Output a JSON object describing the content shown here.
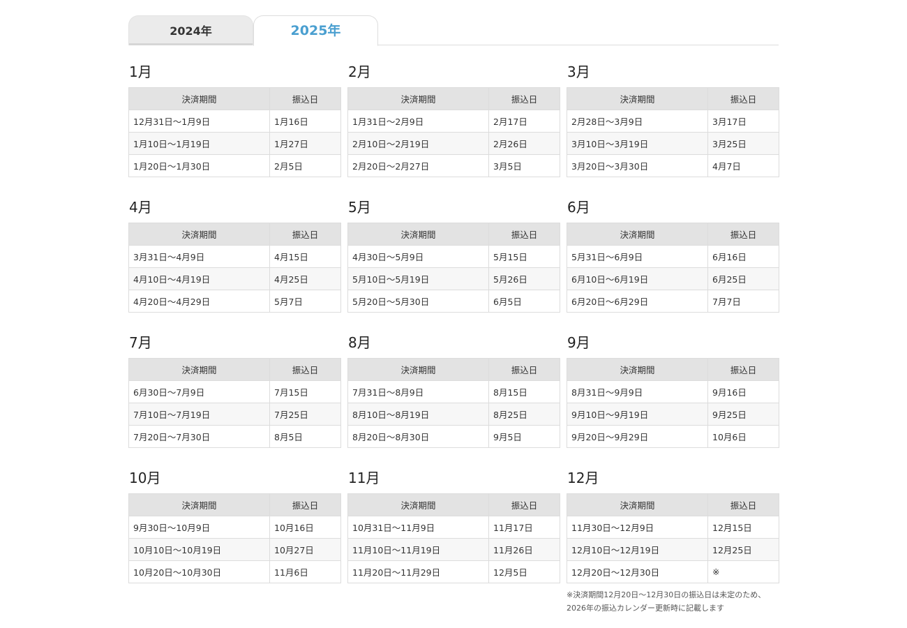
{
  "tabs": [
    {
      "label": "2024年",
      "active": false
    },
    {
      "label": "2025年",
      "active": true
    }
  ],
  "headers": {
    "period": "決済期間",
    "transfer": "振込日"
  },
  "months": [
    {
      "title": "1月",
      "rows": [
        [
          "12月31日〜1月9日",
          "1月16日"
        ],
        [
          "1月10日〜1月19日",
          "1月27日"
        ],
        [
          "1月20日〜1月30日",
          "2月5日"
        ]
      ]
    },
    {
      "title": "2月",
      "rows": [
        [
          "1月31日〜2月9日",
          "2月17日"
        ],
        [
          "2月10日〜2月19日",
          "2月26日"
        ],
        [
          "2月20日〜2月27日",
          "3月5日"
        ]
      ]
    },
    {
      "title": "3月",
      "rows": [
        [
          "2月28日〜3月9日",
          "3月17日"
        ],
        [
          "3月10日〜3月19日",
          "3月25日"
        ],
        [
          "3月20日〜3月30日",
          "4月7日"
        ]
      ]
    },
    {
      "title": "4月",
      "rows": [
        [
          "3月31日〜4月9日",
          "4月15日"
        ],
        [
          "4月10日〜4月19日",
          "4月25日"
        ],
        [
          "4月20日〜4月29日",
          "5月7日"
        ]
      ]
    },
    {
      "title": "5月",
      "rows": [
        [
          "4月30日〜5月9日",
          "5月15日"
        ],
        [
          "5月10日〜5月19日",
          "5月26日"
        ],
        [
          "5月20日〜5月30日",
          "6月5日"
        ]
      ]
    },
    {
      "title": "6月",
      "rows": [
        [
          "5月31日〜6月9日",
          "6月16日"
        ],
        [
          "6月10日〜6月19日",
          "6月25日"
        ],
        [
          "6月20日〜6月29日",
          "7月7日"
        ]
      ]
    },
    {
      "title": "7月",
      "rows": [
        [
          "6月30日〜7月9日",
          "7月15日"
        ],
        [
          "7月10日〜7月19日",
          "7月25日"
        ],
        [
          "7月20日〜7月30日",
          "8月5日"
        ]
      ]
    },
    {
      "title": "8月",
      "rows": [
        [
          "7月31日〜8月9日",
          "8月15日"
        ],
        [
          "8月10日〜8月19日",
          "8月25日"
        ],
        [
          "8月20日〜8月30日",
          "9月5日"
        ]
      ]
    },
    {
      "title": "9月",
      "rows": [
        [
          "8月31日〜9月9日",
          "9月16日"
        ],
        [
          "9月10日〜9月19日",
          "9月25日"
        ],
        [
          "9月20日〜9月29日",
          "10月6日"
        ]
      ]
    },
    {
      "title": "10月",
      "rows": [
        [
          "9月30日〜10月9日",
          "10月16日"
        ],
        [
          "10月10日〜10月19日",
          "10月27日"
        ],
        [
          "10月20日〜10月30日",
          "11月6日"
        ]
      ]
    },
    {
      "title": "11月",
      "rows": [
        [
          "10月31日〜11月9日",
          "11月17日"
        ],
        [
          "11月10日〜11月19日",
          "11月26日"
        ],
        [
          "11月20日〜11月29日",
          "12月5日"
        ]
      ]
    },
    {
      "title": "12月",
      "rows": [
        [
          "11月30日〜12月9日",
          "12月15日"
        ],
        [
          "12月10日〜12月19日",
          "12月25日"
        ],
        [
          "12月20日〜12月30日",
          "※"
        ]
      ]
    }
  ],
  "note": {
    "line1": "※決済期間12月20日〜12月30日の振込日は未定のため、",
    "line2": "2026年の振込カレンダー更新時に記載します"
  },
  "colors": {
    "active_tab": "#4a9fd0",
    "header_bg": "#e3e3e3",
    "alt_row": "#f7f7f7"
  }
}
